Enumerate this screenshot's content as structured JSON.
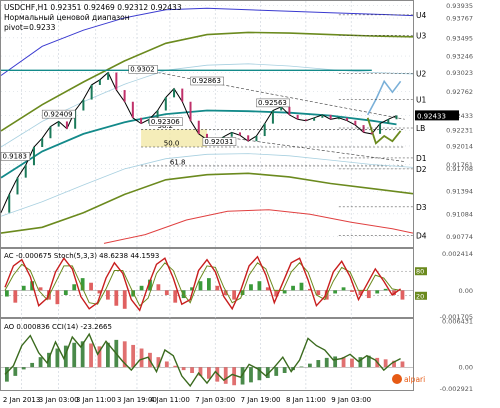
{
  "header": {
    "line1": "USDCHF,H1  0.92351 0.92469 0.92312 0.92433",
    "line2": "Нормальный ценовой диапазон",
    "line3": "pivot=0.9233"
  },
  "colors": {
    "background": "#ffffff",
    "grid": "#c8d0d8",
    "level_dotted": "#c8c8c8",
    "ma_teal": "#138a8a",
    "band_olive": "#6b8a1e",
    "band_blue": "#3a3ad0",
    "band_red": "#e04040",
    "band_light": "#a8d0e0",
    "forecast": "#7ab0d8",
    "fib": "#f2e9a8",
    "price": "#000000",
    "candle_up": "#1a7a5a",
    "candle_down": "#c0306a",
    "price_tag_bg": "#000000",
    "price_tag_fg": "#ffffff",
    "ac_up": "#3a9a3a",
    "ac_down": "#e06060",
    "stoch_main": "#c81e1e",
    "stoch_signal": "#6b8a1e",
    "ao_up": "#4a8a4a",
    "ao_down": "#e07070",
    "cci": "#3a6a1e",
    "pivot_label": "#000000",
    "logo": "#e65a14"
  },
  "chart_data": [
    {
      "id": "main",
      "type": "line",
      "title": "USDCHF,H1",
      "ylim": [
        0.9063,
        0.94
      ],
      "xlim": [
        0,
        100
      ],
      "y_ticks": [
        "0.93935",
        "0.93767",
        "0.93495",
        "0.93246",
        "0.93023",
        "0.92762",
        "0.92433",
        "0.92231",
        "0.92014",
        "0.91761",
        "0.91708",
        "0.91394",
        "0.91084",
        "0.90774"
      ],
      "y_tick_values": [
        0.93935,
        0.93767,
        0.93495,
        0.93246,
        0.93023,
        0.92762,
        0.92433,
        0.92231,
        0.92014,
        0.91761,
        0.91708,
        0.91394,
        0.91084,
        0.90774
      ],
      "x_ticks": [
        "2 Jan 2013",
        "3 Jan 03:00",
        "3 Jan 11:00",
        "3 Jan 19:00",
        "4 Jan 11:00",
        "7 Jan 03:00",
        "7 Jan 19:00",
        "8 Jan 11:00",
        "9 Jan 03:00"
      ],
      "x_tick_values": [
        5,
        14,
        23,
        33,
        41,
        52,
        63,
        74,
        85
      ],
      "current_price": 0.92433,
      "levels": [
        {
          "label": "U4",
          "value": 0.9381
        },
        {
          "label": "U3",
          "value": 0.9353
        },
        {
          "label": "U2",
          "value": 0.9301
        },
        {
          "label": "U1",
          "value": 0.9265
        },
        {
          "label": "LB",
          "value": 0.9226
        },
        {
          "label": "D1",
          "value": 0.9185
        },
        {
          "label": "D2",
          "value": 0.917
        },
        {
          "label": "D3",
          "value": 0.9118
        },
        {
          "label": "D4",
          "value": 0.9079
        }
      ],
      "annotations": [
        {
          "text": "0.9302",
          "x": 31,
          "y": 0.93023
        },
        {
          "text": "0.92863",
          "x": 46,
          "y": 0.92863
        },
        {
          "text": "0.92409",
          "x": 10,
          "y": 0.92409
        },
        {
          "text": "0.92306",
          "x": 36,
          "y": 0.92306
        },
        {
          "text": "0.92563",
          "x": 62,
          "y": 0.92563
        },
        {
          "text": "0.92031",
          "x": 49,
          "y": 0.92031
        },
        {
          "text": "0.9183",
          "x": 0,
          "y": 0.9183
        }
      ],
      "fib_levels": [
        {
          "label": "38.2",
          "value": 0.9224
        },
        {
          "label": "50.0",
          "value": 0.92
        },
        {
          "label": "61.8",
          "value": 0.9174
        }
      ],
      "series": [
        {
          "name": "price",
          "color": "#000000",
          "x": [
            0,
            2,
            4,
            6,
            8,
            10,
            12,
            14,
            16,
            18,
            20,
            22,
            24,
            26,
            28,
            30,
            32,
            34,
            36,
            38,
            40,
            42,
            44,
            46,
            48,
            50,
            52,
            54,
            56,
            58,
            60,
            62,
            64,
            66,
            68,
            70,
            72,
            74,
            76,
            78,
            80,
            82,
            84,
            86,
            88,
            90,
            92,
            94,
            96
          ],
          "y": [
            0.911,
            0.9135,
            0.9158,
            0.9175,
            0.92,
            0.9212,
            0.9228,
            0.9235,
            0.9225,
            0.925,
            0.9265,
            0.9285,
            0.9292,
            0.9302,
            0.9278,
            0.9262,
            0.924,
            0.9232,
            0.9238,
            0.925,
            0.9268,
            0.928,
            0.9262,
            0.9236,
            0.9218,
            0.921,
            0.9206,
            0.9214,
            0.922,
            0.9216,
            0.9208,
            0.9215,
            0.9232,
            0.925,
            0.9255,
            0.9244,
            0.9238,
            0.9236,
            0.924,
            0.9244,
            0.9238,
            0.924,
            0.9236,
            0.923,
            0.922,
            0.9218,
            0.9232,
            0.9238,
            0.9243
          ]
        },
        {
          "name": "teal_ma",
          "color": "#138a8a",
          "x": [
            0,
            10,
            20,
            30,
            40,
            50,
            60,
            70,
            80,
            90,
            96
          ],
          "y": [
            0.9158,
            0.9194,
            0.9218,
            0.9234,
            0.9245,
            0.925,
            0.9249,
            0.9247,
            0.9243,
            0.9236,
            0.9231
          ]
        },
        {
          "name": "olive_upper",
          "color": "#6b8a1e",
          "x": [
            0,
            10,
            20,
            30,
            40,
            50,
            60,
            70,
            80,
            90,
            100
          ],
          "y": [
            0.9222,
            0.9258,
            0.9289,
            0.9318,
            0.9342,
            0.9354,
            0.9357,
            0.9356,
            0.9354,
            0.9352,
            0.9351
          ]
        },
        {
          "name": "olive_lower",
          "color": "#6b8a1e",
          "x": [
            0,
            10,
            20,
            30,
            40,
            50,
            60,
            70,
            80,
            90,
            100
          ],
          "y": [
            0.9082,
            0.909,
            0.911,
            0.9135,
            0.9155,
            0.9162,
            0.9164,
            0.9159,
            0.915,
            0.9143,
            0.9136
          ]
        },
        {
          "name": "blue_upper",
          "color": "#3a3ad0",
          "x": [
            0,
            10,
            20,
            30,
            40,
            50,
            60,
            70,
            80,
            90,
            100
          ],
          "y": [
            0.9298,
            0.9338,
            0.936,
            0.9377,
            0.9388,
            0.939,
            0.9388,
            0.9386,
            0.9384,
            0.9382,
            0.938
          ]
        },
        {
          "name": "red_lower",
          "color": "#e04040",
          "x": [
            25,
            35,
            45,
            55,
            65,
            75,
            85,
            95,
            100
          ],
          "y": [
            0.9068,
            0.908,
            0.91,
            0.9112,
            0.9114,
            0.9108,
            0.9097,
            0.9088,
            0.9082
          ]
        },
        {
          "name": "light_upper",
          "color": "#a8d0e0",
          "x": [
            0,
            10,
            20,
            30,
            40,
            50,
            60,
            70,
            80,
            90,
            100
          ],
          "y": [
            0.92,
            0.9235,
            0.9262,
            0.9286,
            0.9305,
            0.9312,
            0.9314,
            0.9311,
            0.9306,
            0.9302,
            0.93
          ]
        },
        {
          "name": "light_lower",
          "color": "#a8d0e0",
          "x": [
            0,
            10,
            20,
            30,
            40,
            50,
            60,
            70,
            80,
            90,
            100
          ],
          "y": [
            0.9105,
            0.9125,
            0.9148,
            0.917,
            0.9184,
            0.919,
            0.9191,
            0.9188,
            0.9182,
            0.9176,
            0.9172
          ]
        },
        {
          "name": "forecast_up",
          "color": "#7ab0d8",
          "x": [
            89,
            91,
            93,
            95,
            97
          ],
          "y": [
            0.9244,
            0.9265,
            0.929,
            0.9275,
            0.929
          ]
        },
        {
          "name": "forecast_down",
          "color": "#6b8a1e",
          "x": [
            89,
            91,
            93,
            95,
            97
          ],
          "y": [
            0.924,
            0.9205,
            0.9215,
            0.9208,
            0.9222
          ]
        }
      ]
    },
    {
      "id": "ac_stoch",
      "type": "bar",
      "title": "AC -0.000675  Stoch(5,3,3) 48.6238 44.1593",
      "ylim": [
        -0.0018,
        0.0027
      ],
      "y_ticks": [
        "0.002414",
        "0.00",
        "-0.001705"
      ],
      "y_tick_values": [
        0.002414,
        0.0,
        -0.001705
      ],
      "stoch_levels": [
        {
          "label": "80",
          "value": 0.00125
        },
        {
          "label": "20",
          "value": -0.00035
        }
      ],
      "ac_values": [
        -0.0004,
        -0.0008,
        0.0003,
        0.0006,
        0.0002,
        -0.0006,
        -0.0009,
        -0.0003,
        0.0004,
        0.0008,
        0.0005,
        -0.0002,
        -0.0006,
        -0.001,
        -0.0012,
        -0.0004,
        0.0003,
        0.0007,
        0.0004,
        -0.0003,
        -0.0008,
        -0.0005,
        0.0002,
        0.0006,
        0.0008,
        0.0003,
        -0.0003,
        -0.0006,
        -0.0003,
        0.0004,
        0.0006,
        0.0002,
        -0.0004,
        -0.0002,
        0.0003,
        0.0005,
        0.0001,
        -0.0003,
        -0.0006,
        -0.0002,
        0.0002,
        -0.0001,
        -0.0003,
        -0.0005,
        -0.0002,
        0.0001,
        -0.0003,
        -0.0006
      ],
      "stoch_main": [
        0.0002,
        0.0016,
        0.002,
        0.0009,
        -0.001,
        -0.0005,
        0.0012,
        0.0021,
        0.0014,
        -0.0004,
        -0.0012,
        -0.0008,
        0.0008,
        0.0018,
        0.0011,
        -0.0006,
        -0.0013,
        0.0003,
        0.0017,
        0.0021,
        0.0008,
        -0.0009,
        -0.0006,
        0.0013,
        0.002,
        0.0012,
        -0.0004,
        -0.0012,
        0.0,
        0.0016,
        0.0022,
        0.001,
        -0.0008,
        0.0005,
        0.0018,
        0.0021,
        0.0007,
        -0.001,
        -0.0004,
        0.0012,
        0.0019,
        0.0009,
        -0.0006,
        0.0004,
        0.0014,
        0.0006,
        -0.0003,
        0.0001
      ],
      "stoch_signal": [
        0.0,
        0.001,
        0.0017,
        0.0013,
        0.0,
        -0.0006,
        0.0005,
        0.0016,
        0.0016,
        0.0004,
        -0.0008,
        -0.0009,
        0.0001,
        0.0013,
        0.0013,
        0.0001,
        -0.001,
        -0.0005,
        0.0011,
        0.0018,
        0.0013,
        -0.0001,
        -0.0008,
        0.0006,
        0.0016,
        0.0015,
        0.0002,
        -0.0008,
        -0.0005,
        0.001,
        0.0018,
        0.0014,
        0.0,
        0.0,
        0.0012,
        0.0018,
        0.0012,
        -0.0003,
        -0.0006,
        0.0006,
        0.0015,
        0.0012,
        0.0,
        0.0,
        0.001,
        0.0008,
        0.0001,
        0.0
      ]
    },
    {
      "id": "ao_cci",
      "type": "bar",
      "title": "AO 0.000836  CCI(14) -23.2665",
      "ylim": [
        -0.0033,
        0.0067
      ],
      "y_ticks": [
        "0.006431",
        "0.00",
        "-0.002921"
      ],
      "y_tick_values": [
        0.006431,
        0.0,
        -0.002921
      ],
      "ao_values": [
        -0.002,
        -0.0012,
        -0.0003,
        0.0006,
        0.0014,
        0.002,
        0.0026,
        0.003,
        0.0034,
        0.0036,
        0.0033,
        0.0029,
        0.0034,
        0.0038,
        0.0036,
        0.0031,
        0.0026,
        0.002,
        0.0014,
        0.0008,
        0.0002,
        -0.0004,
        -0.0008,
        -0.0012,
        -0.0016,
        -0.002,
        -0.0023,
        -0.0025,
        -0.0024,
        -0.0021,
        -0.0018,
        -0.0015,
        -0.0012,
        -0.0008,
        -0.0004,
        0.0001,
        0.0005,
        0.001,
        0.0013,
        0.0015,
        0.0014,
        0.0012,
        0.0014,
        0.0016,
        0.0013,
        0.0011,
        0.0009,
        0.0008
      ],
      "cci_values": [
        -0.001,
        0.0002,
        0.003,
        0.0044,
        0.002,
        0.0006,
        0.0035,
        0.0012,
        0.0042,
        0.0028,
        0.0046,
        0.0018,
        0.0036,
        0.0022,
        0.0008,
        -0.0004,
        0.001,
        0.0014,
        -0.0006,
        0.0024,
        0.0016,
        -0.0012,
        -0.0026,
        -0.0008,
        -0.0022,
        -0.0006,
        -0.0018,
        -0.001,
        -0.0014,
        0.0004,
        -0.0002,
        -0.0012,
        0.0,
        0.0014,
        -0.0006,
        0.001,
        0.004,
        0.003,
        0.0024,
        0.001,
        0.0012,
        0.0018,
        0.0008,
        0.0016,
        0.001,
        -0.0004,
        0.0006,
        0.0012
      ]
    }
  ],
  "logo": {
    "text": "alpari"
  }
}
